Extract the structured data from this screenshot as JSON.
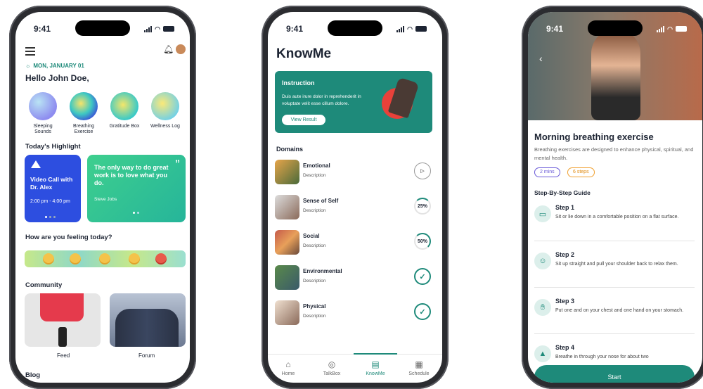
{
  "phone_home": {
    "time": "9:41",
    "date": "MON, JANUARY 01",
    "greeting": "Hello John Doe,",
    "categories": [
      {
        "label": "Sleeping Sounds"
      },
      {
        "label": "Breathing Exercise"
      },
      {
        "label": "Gratitude Box"
      },
      {
        "label": "Wellness Log"
      }
    ],
    "highlight_title": "Today's Highlight",
    "call_card": {
      "title": "Video Call with Dr. Alex",
      "time": "2:00 pm - 4:00 pm"
    },
    "quote_card": {
      "quote": "The only way to do great work is to love what you do.",
      "author": "Steve Jobs"
    },
    "feeling_title": "How are you feeling today?",
    "community_title": "Community",
    "feed_label": "Feed",
    "forum_label": "Forum",
    "blog_title": "Blog"
  },
  "phone_knowme": {
    "time": "9:41",
    "title": "KnowMe",
    "instruction": {
      "title": "Instruction",
      "text": "Duis aute irure dolor in reprehenderit in voluptate velit esse cillum dolore.",
      "button": "View Result"
    },
    "domains_title": "Domains",
    "domains": [
      {
        "name": "Emotional",
        "desc": "Description",
        "status": "play"
      },
      {
        "name": "Sense of Self",
        "desc": "Description",
        "status": "25%"
      },
      {
        "name": "Social",
        "desc": "Description",
        "status": "50%"
      },
      {
        "name": "Environmental",
        "desc": "Description",
        "status": "done"
      },
      {
        "name": "Physical",
        "desc": "Description",
        "status": "done"
      }
    ],
    "tabs": [
      {
        "label": "Home",
        "active": false
      },
      {
        "label": "TalkBox",
        "active": false
      },
      {
        "label": "KnowMe",
        "active": true
      },
      {
        "label": "Schedule",
        "active": false
      }
    ]
  },
  "phone_breathing": {
    "time": "9:41",
    "title": "Morning breathing exercise",
    "subtitle": "Breathing exercises are designed to enhance physical, spiritual, and mental health.",
    "chip_duration": "2 mins",
    "chip_steps": "6 steps",
    "guide_title": "Step-By-Step Guide",
    "steps": [
      {
        "title": "Step 1",
        "desc": "Sit or lie down in a comfortable position on a flat surface.",
        "icon": "mat-icon"
      },
      {
        "title": "Step 2",
        "desc": "Sit up straight and pull your shoulder back to relax them.",
        "icon": "person-icon"
      },
      {
        "title": "Step 3",
        "desc": "Put one and on your chest and one hand on your stomach.",
        "icon": "hand-icon"
      },
      {
        "title": "Step 4",
        "desc": "Breathe in through your nose for about two",
        "icon": "meditate-icon"
      }
    ],
    "start_button": "Start"
  },
  "colors": {
    "teal": "#1e8a7a",
    "blue": "#2d4ee0",
    "green": "#2ec58a"
  }
}
